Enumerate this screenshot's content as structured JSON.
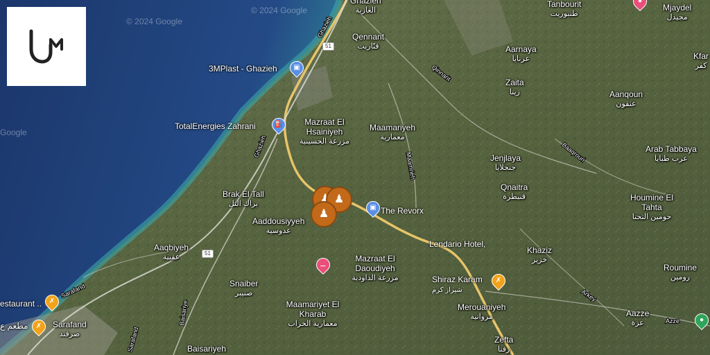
{
  "map": {
    "watermark": "© 2024 Google",
    "watermark_left": "Google",
    "places": [
      {
        "en": "Ghazieh",
        "ar": "الغازية",
        "id": "ghazieh-top"
      },
      {
        "en": "Qennarit",
        "ar": "قنّاريت",
        "id": "qennarit"
      },
      {
        "en": "Mazraat El Hsainiyeh",
        "ar": "مزرعة الحسينية",
        "id": "mazraat-hsainiyeh"
      },
      {
        "en": "Maamariyeh",
        "ar": "معمارية",
        "id": "maamariyeh"
      },
      {
        "en": "Aarnaya",
        "ar": "عرنايا",
        "id": "aarnaya"
      },
      {
        "en": "Zaita",
        "ar": "زيتا",
        "id": "zaita"
      },
      {
        "en": "Aanqoun",
        "ar": "عنقون",
        "id": "aanqoun"
      },
      {
        "en": "Tanbourit",
        "ar": "طنبوريت",
        "id": "tanbourit"
      },
      {
        "en": "Mjaydel",
        "ar": "مجيدل",
        "id": "mjaydel"
      },
      {
        "en": "Kfar",
        "ar": "كفر",
        "id": "kfar"
      },
      {
        "en": "Jenjlaya",
        "ar": "جنجلايا",
        "id": "jenjlaya"
      },
      {
        "en": "Qnaitra",
        "ar": "قنيطرة",
        "id": "qnaitra"
      },
      {
        "en": "Arab Tabbaya",
        "ar": "عرب طبايا",
        "id": "arab-tabbaya"
      },
      {
        "en": "Houmine El Tahta",
        "ar": "حومين التحتا",
        "id": "houmine"
      },
      {
        "en": "Brak El Tall",
        "ar": "براك التل",
        "id": "brak-el-tall"
      },
      {
        "en": "Aaddousiyyeh",
        "ar": "عدوسية",
        "id": "aaddousiyyeh"
      },
      {
        "en": "Aaqbiyeh",
        "ar": "عقبية",
        "id": "aaqbiyeh"
      },
      {
        "en": "Mazraat El Daoudiyeh",
        "ar": "مزرعة الداودية",
        "id": "mazraat-daoudiyeh"
      },
      {
        "en": "Khaziz",
        "ar": "خزيز",
        "id": "khaziz"
      },
      {
        "en": "Roumine",
        "ar": "رومين",
        "id": "roumine"
      },
      {
        "en": "Snaiber",
        "ar": "صنيبر",
        "id": "snaiber"
      },
      {
        "en": "Maamariyet El Kharab",
        "ar": "معمارية الخراب",
        "id": "maamariyet-kharab"
      },
      {
        "en": "Merouaniyeh",
        "ar": "مروانية",
        "id": "merouaniyeh"
      },
      {
        "en": "Aazze",
        "ar": "عزة",
        "id": "aazze"
      },
      {
        "en": "Sarafand",
        "ar": "صرفند",
        "id": "sarafand"
      },
      {
        "en": "Zefta",
        "ar": "زفتا",
        "id": "zefta"
      },
      {
        "en": "Baisariyeh",
        "ar": "",
        "id": "baisariyeh"
      }
    ],
    "pois": [
      {
        "name": "3MPlast - Ghazieh",
        "type": "shopping",
        "id": "poi-3mplast"
      },
      {
        "name": "TotalEnergies Zahrani",
        "type": "fuel",
        "id": "poi-totalenergies"
      },
      {
        "name": "The Revorx",
        "type": "shopping",
        "id": "poi-revorx"
      },
      {
        "name": "Lendario Hotel,",
        "type": "hotel",
        "id": "poi-lendario"
      },
      {
        "name": "Shiraz Karam",
        "ar": "شيراز كرم",
        "type": "restaurant",
        "id": "poi-shiraz"
      },
      {
        "name": "estaurant ..",
        "type": "restaurant",
        "id": "poi-restaurant"
      },
      {
        "name": "مطعم ع",
        "type": "restaurant",
        "id": "poi-restaurant-ar"
      }
    ],
    "road_labels": [
      "Ghazieh",
      "Ghazieh",
      "Qinnarit",
      "Maamrieh",
      "Baaqrouri",
      "Arkey",
      "Sarafand",
      "Baisariye",
      "Sarafand",
      "Azze"
    ],
    "road_shields": [
      "51",
      "51"
    ],
    "marker_icon": "worker-icon",
    "colors": {
      "sea_deep": "#1f3f7a",
      "sea_shallow": "#2f8f9a",
      "land": "#5b6a43",
      "cluster": "#c26a1a",
      "highway": "#e7c46a",
      "poi_blue": "#5b8fe6",
      "poi_orange": "#f2a31b",
      "poi_pink": "#e94f7a",
      "poi_green": "#2fa55a"
    }
  },
  "logo": {
    "icon": "um-logo-icon"
  }
}
